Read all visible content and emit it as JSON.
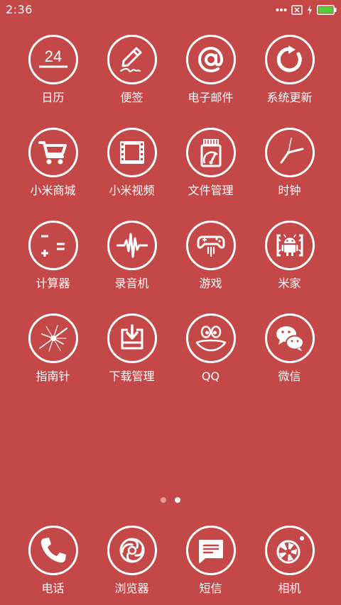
{
  "status_bar": {
    "time": "2:36",
    "battery_color": "#4cd137"
  },
  "apps": [
    {
      "label": "日历",
      "icon": "calendar-icon",
      "date": "24"
    },
    {
      "label": "便签",
      "icon": "notes-icon"
    },
    {
      "label": "电子邮件",
      "icon": "email-icon"
    },
    {
      "label": "系统更新",
      "icon": "system-update-icon"
    },
    {
      "label": "小米商城",
      "icon": "shopping-cart-icon"
    },
    {
      "label": "小米视频",
      "icon": "video-icon"
    },
    {
      "label": "文件管理",
      "icon": "file-manager-icon"
    },
    {
      "label": "时钟",
      "icon": "clock-icon"
    },
    {
      "label": "计算器",
      "icon": "calculator-icon"
    },
    {
      "label": "录音机",
      "icon": "recorder-icon"
    },
    {
      "label": "游戏",
      "icon": "gamepad-icon"
    },
    {
      "label": "米家",
      "icon": "mijia-icon"
    },
    {
      "label": "指南针",
      "icon": "compass-icon"
    },
    {
      "label": "下载管理",
      "icon": "download-icon"
    },
    {
      "label": "QQ",
      "icon": "qq-icon"
    },
    {
      "label": "微信",
      "icon": "wechat-icon"
    }
  ],
  "page_indicator": {
    "pages": 2,
    "current": 2
  },
  "dock": [
    {
      "label": "电话",
      "icon": "phone-icon"
    },
    {
      "label": "浏览器",
      "icon": "browser-icon"
    },
    {
      "label": "短信",
      "icon": "sms-icon"
    },
    {
      "label": "相机",
      "icon": "camera-icon"
    }
  ],
  "colors": {
    "background": "#c44848",
    "foreground": "#ffffff"
  }
}
